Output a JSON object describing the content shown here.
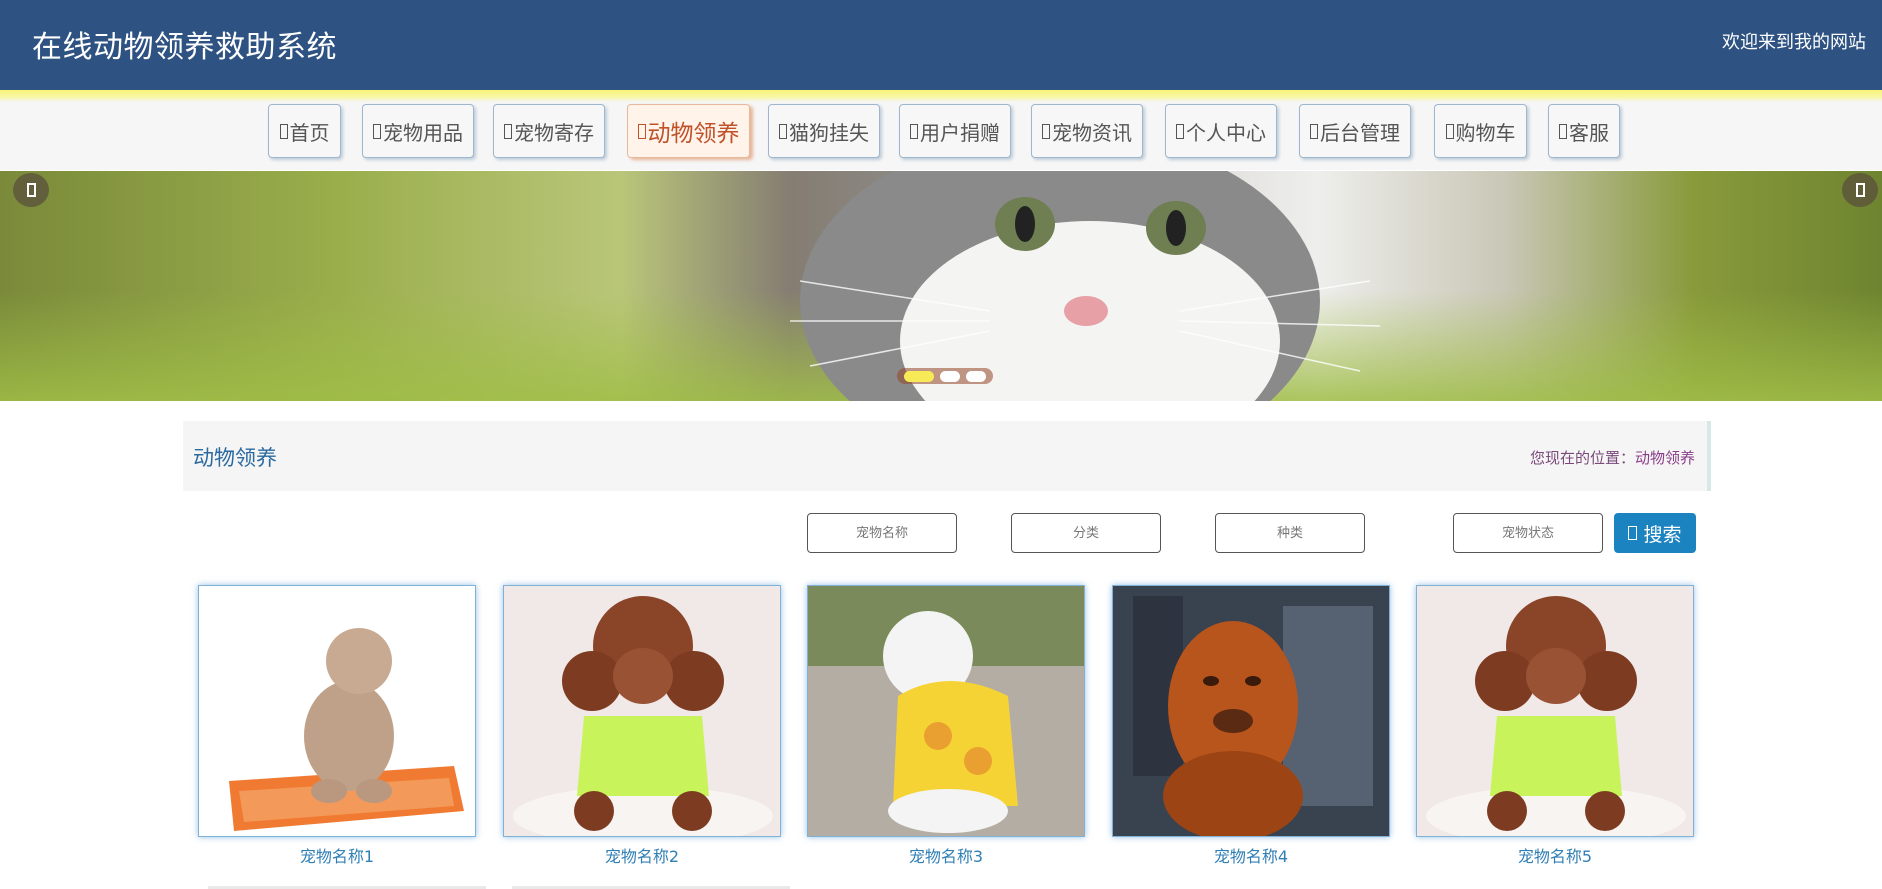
{
  "header": {
    "title": "在线动物领养救助系统",
    "welcome": "欢迎来到我的网站"
  },
  "nav": {
    "items": [
      {
        "label": "首页",
        "icon": "nav-icon"
      },
      {
        "label": "宠物用品",
        "icon": "nav-icon"
      },
      {
        "label": "宠物寄存",
        "icon": "nav-icon"
      },
      {
        "label": "动物领养",
        "icon": "nav-icon",
        "active": true
      },
      {
        "label": "猫狗挂失",
        "icon": "nav-icon"
      },
      {
        "label": "用户捐赠",
        "icon": "nav-icon"
      },
      {
        "label": "宠物资讯",
        "icon": "nav-icon"
      },
      {
        "label": "个人中心",
        "icon": "nav-icon"
      },
      {
        "label": "后台管理",
        "icon": "nav-icon"
      },
      {
        "label": "购物车",
        "icon": "nav-icon"
      },
      {
        "label": "客服",
        "icon": "nav-icon"
      }
    ]
  },
  "banner": {
    "slide_count": 3,
    "active_slide": 1
  },
  "breadcrumb": {
    "page_title": "动物领养",
    "location_label": "您现在的位置：",
    "location_value": "动物领养"
  },
  "search": {
    "pet_name_placeholder": "宠物名称",
    "category_placeholder": "分类",
    "species_placeholder": "种类",
    "status_placeholder": "宠物状态",
    "button_label": "搜索"
  },
  "pets": [
    {
      "name": "宠物名称1"
    },
    {
      "name": "宠物名称2"
    },
    {
      "name": "宠物名称3"
    },
    {
      "name": "宠物名称4"
    },
    {
      "name": "宠物名称5"
    }
  ],
  "colors": {
    "header_bg": "#2e5281",
    "accent_blue": "#1b84c0",
    "active_nav": "#c0522a",
    "stripe_yellow": "#f8f37a"
  }
}
